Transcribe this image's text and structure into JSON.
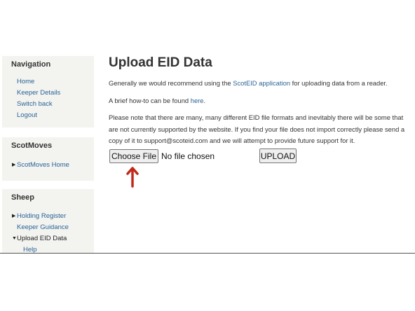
{
  "sidebar": {
    "navigation": {
      "title": "Navigation",
      "items": [
        "Home",
        "Keeper Details",
        "Switch back",
        "Logout"
      ]
    },
    "scotmoves": {
      "title": "ScotMoves",
      "items": [
        "ScotMoves Home"
      ]
    },
    "sheep": {
      "title": "Sheep",
      "items": [
        "Holding Register",
        "Keeper Guidance",
        "Upload EID Data",
        "Help"
      ]
    }
  },
  "main": {
    "title": "Upload EID Data",
    "para1": {
      "before": "Generally we would recommend using the ",
      "link": "ScotEID application",
      "after": " for uploading data from a reader."
    },
    "para2": {
      "before": "A brief how-to can be found ",
      "link": "here",
      "after": "."
    },
    "para3": "Please note that there are many, many different EID file formats and inevitably there will be some that are not currently supported by the website. If you find your file does not import correctly please send a copy of it to support@scoteid.com and we will attempt to provide future support for it.",
    "choose_file_label": "Choose File",
    "no_file_text": "No file chosen",
    "upload_label": "UPLOAD"
  },
  "annotation": {
    "arrow_color": "#c0281b",
    "icon": "up-arrow-icon"
  }
}
